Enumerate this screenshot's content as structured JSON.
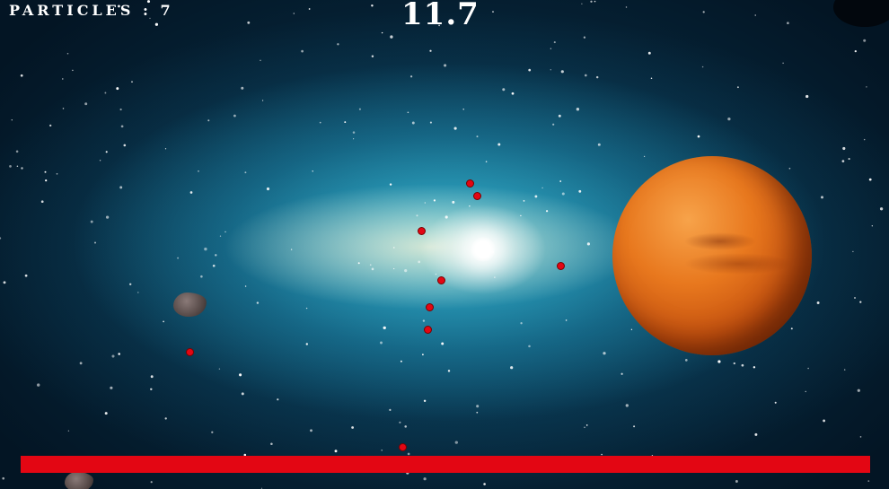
{
  "hud": {
    "particles_text": "PARTICLES : 7",
    "timer_text": "11.7"
  },
  "health_bar": {
    "fill_fraction": 1.0,
    "color": "#e30613"
  },
  "colors": {
    "planet": "#e8781e",
    "particle": "#e30613",
    "space": "#031524",
    "galaxy": "#3cc8e1"
  },
  "entities": {
    "planet": "mars-planet",
    "star": "glowing-star",
    "asteroid": "asteroid-rock",
    "particle": "red-particle"
  }
}
